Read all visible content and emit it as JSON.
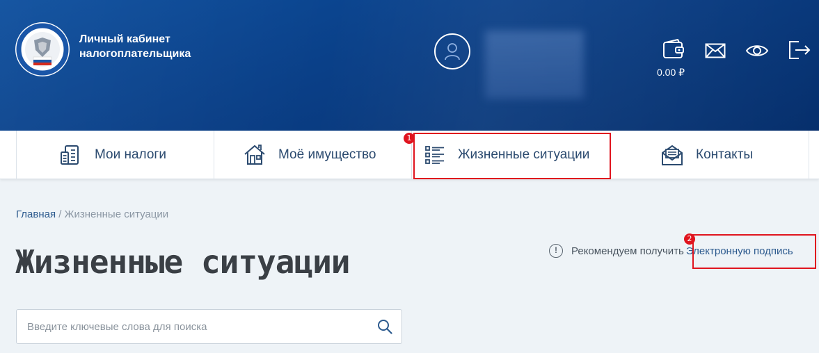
{
  "header": {
    "title_line1": "Личный кабинет",
    "title_line2": "налогоплательщика",
    "balance": "0.00 ₽"
  },
  "nav": {
    "items": [
      {
        "label": "Мои налоги",
        "icon": "tax-document-icon"
      },
      {
        "label": "Моё имущество",
        "icon": "house-icon"
      },
      {
        "label": "Жизненные ситуации",
        "icon": "list-icon"
      },
      {
        "label": "Контакты",
        "icon": "envelope-open-icon"
      }
    ]
  },
  "annotations": {
    "badge1": "1",
    "badge2": "2"
  },
  "breadcrumb": {
    "home": "Главная",
    "separator": " / ",
    "current": "Жизненные ситуации"
  },
  "page": {
    "title": "Жизненные ситуации"
  },
  "recommend": {
    "info_glyph": "!",
    "text": "Рекомендуем получить",
    "link": "Электронную подпись"
  },
  "search": {
    "placeholder": "Введите ключевые слова для поиска",
    "value": ""
  },
  "colors": {
    "header_bg": "#0a3f87",
    "nav_text": "#2b4a6f",
    "link": "#2c5a8e",
    "annotation": "#e0141e"
  }
}
